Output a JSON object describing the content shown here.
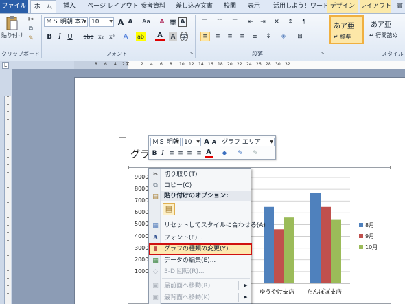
{
  "tabs": {
    "file": "ファイル",
    "home": "ホーム",
    "insert": "挿入",
    "page_layout": "ページ レイアウト",
    "references": "参考資料",
    "mailings": "差し込み文書",
    "review": "校閲",
    "view": "表示",
    "addin": "活用しよう！ワード",
    "design": "デザイン",
    "layout": "レイアウト",
    "more": "書"
  },
  "ribbon": {
    "paste_label": "貼り付け",
    "clipboard_group": "クリップボード",
    "font_group": "フォント",
    "paragraph_group": "段落",
    "style_group": "スタイル",
    "font_name": "ＭＳ 明朝 本ﾌ",
    "font_size": "10",
    "bold": "B",
    "italic": "I",
    "underline": "U",
    "strike": "abe",
    "subscript": "x₂",
    "superscript": "x²",
    "grow_font": "A",
    "shrink_font": "A",
    "change_case": "Aa",
    "clear_format": "A",
    "font_color": "A",
    "char_border": "A",
    "highlight": "ab",
    "style1_sample": "あア亜",
    "style1_name": "↵ 標準",
    "style2_sample": "あア亜",
    "style2_name": "↵ 行間詰め"
  },
  "ruler_numbers": [
    "8",
    "6",
    "4",
    "2",
    "2",
    "4",
    "6",
    "8",
    "10",
    "12",
    "14",
    "16",
    "18",
    "20",
    "22",
    "24",
    "26",
    "28",
    "30",
    "32"
  ],
  "document": {
    "heading_fragment": "グラ"
  },
  "mini_toolbar": {
    "font_name": "ＭＳ 明朝",
    "font_size": "10",
    "element_select": "グラフ エリア",
    "bold": "B",
    "italic": "I"
  },
  "context_menu": {
    "cut": "切り取り(T)",
    "copy": "コピー(C)",
    "paste_options": "貼り付けのオプション:",
    "reset_style": "リセットしてスタイルに合わせる(A)",
    "font": "フォント(F)...",
    "change_chart_type": "グラフの種類の変更(Y)...",
    "edit_data": "データの編集(E)...",
    "rotation_3d": "3-D 回転(R)...",
    "bring_front": "最前面へ移動(R)",
    "send_back": "最背面へ移動(K)"
  },
  "chart_data": {
    "type": "bar",
    "categories": [
      "ゆうやけ支店",
      "たんぽぽ支店"
    ],
    "series": [
      {
        "name": "8月",
        "values": [
          6500,
          7700
        ],
        "color": "#4f81bd"
      },
      {
        "name": "9月",
        "values": [
          4600,
          6500
        ],
        "color": "#c0504d"
      },
      {
        "name": "10月",
        "values": [
          5600,
          5400
        ],
        "color": "#9bbb59"
      }
    ],
    "yticks": [
      "9000",
      "8000",
      "7000",
      "6000",
      "5000",
      "4000",
      "3000",
      "2000",
      "1000"
    ],
    "ylim": [
      0,
      9000
    ],
    "legend": "right"
  },
  "colors": {
    "accent_file_tab": "#2a5ea8",
    "highlight_border": "#c00000",
    "design_tab_bg": "#fbe9a9"
  }
}
